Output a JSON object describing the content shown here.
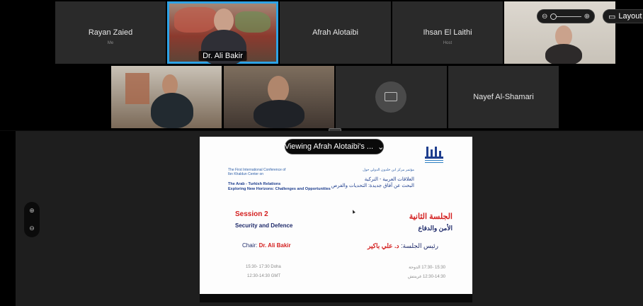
{
  "participants": {
    "rayan": {
      "name": "Rayan Zaied",
      "sub": "Me"
    },
    "ali": {
      "name": "Dr. Ali Bakir"
    },
    "afrah": {
      "name": "Afrah Alotaibi"
    },
    "ihsan": {
      "name": "Ihsan El Laithi",
      "sub": "Host"
    },
    "nayef": {
      "name": "Nayef Al-Shamari"
    }
  },
  "toolbar": {
    "layout_label": "Layout",
    "zoom_out_icon": "zoom-out-icon",
    "zoom_in_icon": "zoom-in-icon",
    "zoom_level": 0
  },
  "share": {
    "viewing_label": "Viewing Afrah Alotaibi's ..."
  },
  "slide": {
    "conf_en_line1": "The First International Conference of",
    "conf_en_line2": "Ibn Khaldun Center on",
    "conf_en_title1": "The Arab - Turkish Relations",
    "conf_en_title2": "Exploring New Horizons: Challenges and Opportunities",
    "conf_ar_line1": "مؤتمر مركز ابن خلدون الدولي حول",
    "conf_ar_title1": "العلاقات العربية - التركية",
    "conf_ar_title2": "البحث عن آفاق جديدة: التحديات والفرص",
    "session_en": "Session 2",
    "topic_en": "Security and Defence",
    "session_ar": "الجلسة الثانية",
    "topic_ar": "الأمن والدفاع",
    "chair_en_label": "Chair: ",
    "chair_en_name": "Dr. Ali Bakir",
    "chair_ar_label": "رئيس الجلسة: ",
    "chair_ar_name": "د. علي باكير",
    "time_en_1": "15:30- 17:30 Doha",
    "time_en_2": "12:30-14:30 GMT",
    "time_ar_1": "15:30 -17:30 الدوحة",
    "time_ar_2": "12:30-14:30 غرينتش"
  },
  "colors": {
    "active_speaker": "#2ea3e6",
    "slide_red": "#d42020",
    "slide_navy": "#1e2a6a"
  }
}
